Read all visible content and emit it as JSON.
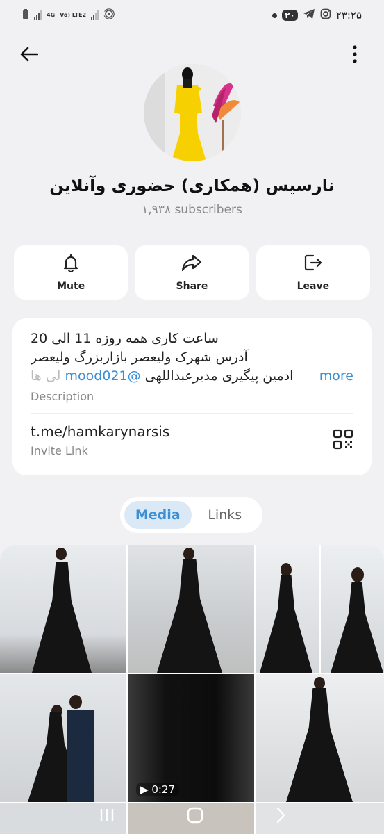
{
  "status_bar": {
    "network_1": "4G",
    "network_2": "Vo) LTE2",
    "notification_badge": "۲۰",
    "time": "۲۳:۲۵"
  },
  "header": {
    "back_icon": "arrow-left-icon",
    "menu_icon": "more-vert-icon"
  },
  "channel": {
    "title": "نارسیس (همکاری) حضوری وآنلاین",
    "subscribers": "۱,۹۳۸ subscribers"
  },
  "actions": [
    {
      "label": "Mute",
      "icon": "bell-icon"
    },
    {
      "label": "Share",
      "icon": "share-icon"
    },
    {
      "label": "Leave",
      "icon": "leave-icon"
    }
  ],
  "info": {
    "description_line1": "ساعت کاری همه روزه 11 الی 20",
    "description_line2": "آدرس شهرک ولیعصر بازاربزرگ ولیعصر",
    "description_line3_text": "ادمین پیگیری  مدیرعبداللهی",
    "description_mention": "@mood021",
    "description_fade": "لی ها",
    "more_label": "more",
    "description_label": "Description",
    "invite_link": "t.me/hamkarynarsis",
    "invite_label": "Invite Link"
  },
  "tabs": [
    {
      "label": "Media",
      "active": true
    },
    {
      "label": "Links",
      "active": false
    }
  ],
  "media": {
    "video_duration": "0:27"
  },
  "colors": {
    "accent": "#3a8fd6",
    "background": "#f1f1f4",
    "card": "#ffffff"
  }
}
